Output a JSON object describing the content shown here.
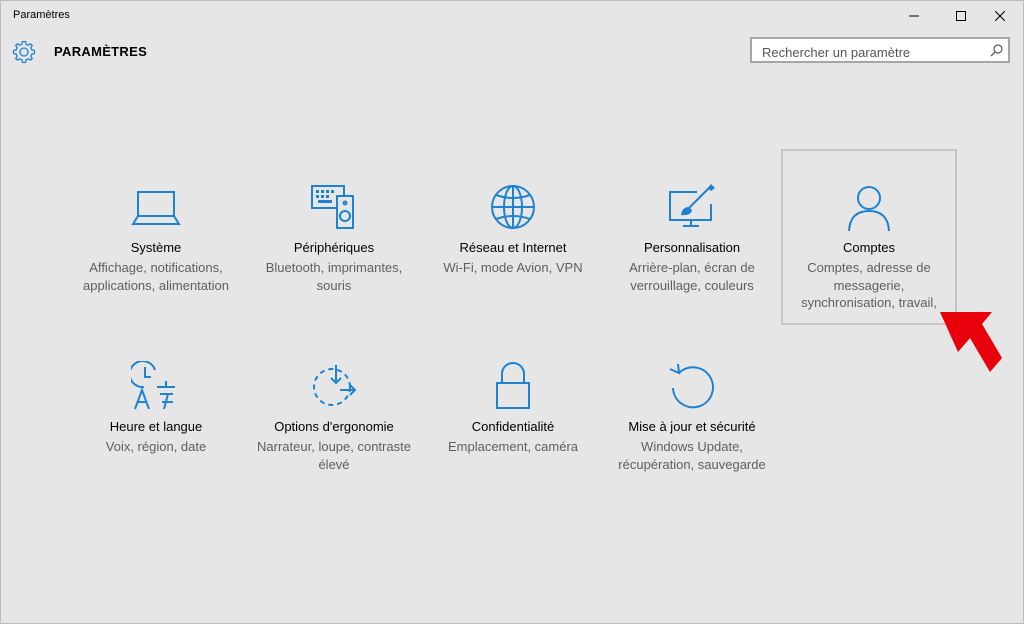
{
  "window": {
    "title": "Paramètres"
  },
  "header": {
    "title": "PARAMÈTRES"
  },
  "search": {
    "placeholder": "Rechercher un paramètre"
  },
  "colors": {
    "accent": "#1e82d2",
    "arrow": "#e8000b"
  },
  "tiles": [
    {
      "icon": "laptop-icon",
      "label": "Système",
      "desc": "Affichage, notifications, applications, alimentation"
    },
    {
      "icon": "keyboard-speaker-icon",
      "label": "Périphériques",
      "desc": "Bluetooth, imprimantes, souris"
    },
    {
      "icon": "globe-icon",
      "label": "Réseau et Internet",
      "desc": "Wi-Fi, mode Avion, VPN"
    },
    {
      "icon": "paintbrush-monitor-icon",
      "label": "Personnalisation",
      "desc": "Arrière-plan, écran de verrouillage, couleurs"
    },
    {
      "icon": "person-icon",
      "label": "Comptes",
      "desc": "Comptes, adresse de messagerie, synchronisation, travail,"
    },
    {
      "icon": "clock-language-icon",
      "label": "Heure et langue",
      "desc": "Voix, région, date"
    },
    {
      "icon": "ease-of-access-icon",
      "label": "Options d'ergonomie",
      "desc": "Narrateur, loupe, contraste élevé"
    },
    {
      "icon": "lock-icon",
      "label": "Confidentialité",
      "desc": "Emplacement, caméra"
    },
    {
      "icon": "update-icon",
      "label": "Mise à jour et sécurité",
      "desc": "Windows Update, récupération, sauvegarde"
    }
  ]
}
